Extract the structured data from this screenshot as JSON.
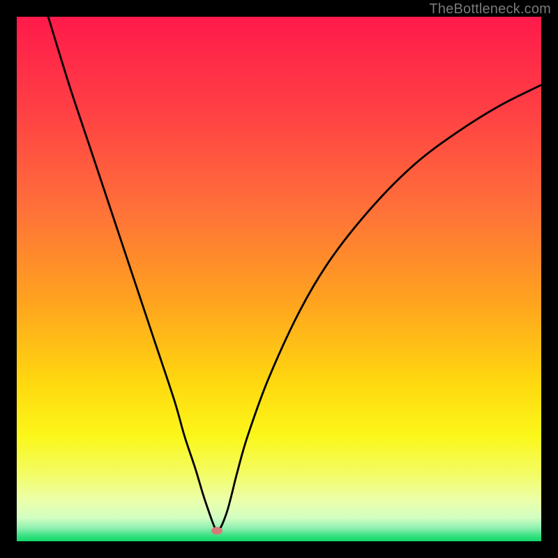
{
  "watermark": {
    "text": "TheBottleneck.com"
  },
  "chart_data": {
    "type": "line",
    "title": "",
    "xlabel": "",
    "ylabel": "",
    "xlim": [
      0,
      100
    ],
    "ylim": [
      0,
      100
    ],
    "grid": false,
    "legend": false,
    "series": [
      {
        "name": "bottleneck-curve",
        "color": "#000000",
        "x": [
          6,
          10,
          14,
          18,
          22,
          26,
          30,
          32,
          34,
          35.5,
          36.5,
          37.2,
          37.8,
          38.2,
          38.8,
          39.5,
          40.2,
          41,
          42,
          44,
          48,
          54,
          60,
          68,
          76,
          84,
          92,
          100
        ],
        "y": [
          100,
          87,
          75,
          63,
          51,
          39,
          27,
          20,
          14,
          9,
          6,
          4,
          2.5,
          2,
          2.5,
          4,
          6,
          9,
          13,
          20,
          31,
          44,
          54,
          64,
          72,
          78,
          83,
          87
        ]
      }
    ],
    "marker": {
      "x_pct": 38.2,
      "y_pct": 2,
      "color": "#d77b78"
    },
    "background_gradient": {
      "stops": [
        {
          "offset": 0.0,
          "color": "#ff1a4b"
        },
        {
          "offset": 0.18,
          "color": "#ff4044"
        },
        {
          "offset": 0.36,
          "color": "#ff6f3a"
        },
        {
          "offset": 0.54,
          "color": "#ffa21f"
        },
        {
          "offset": 0.7,
          "color": "#ffd90f"
        },
        {
          "offset": 0.8,
          "color": "#fbf71a"
        },
        {
          "offset": 0.87,
          "color": "#f3fc62"
        },
        {
          "offset": 0.92,
          "color": "#ecffa8"
        },
        {
          "offset": 0.955,
          "color": "#d4ffc2"
        },
        {
          "offset": 0.975,
          "color": "#8eefb0"
        },
        {
          "offset": 0.99,
          "color": "#35e07f"
        },
        {
          "offset": 1.0,
          "color": "#13d96b"
        }
      ]
    }
  }
}
